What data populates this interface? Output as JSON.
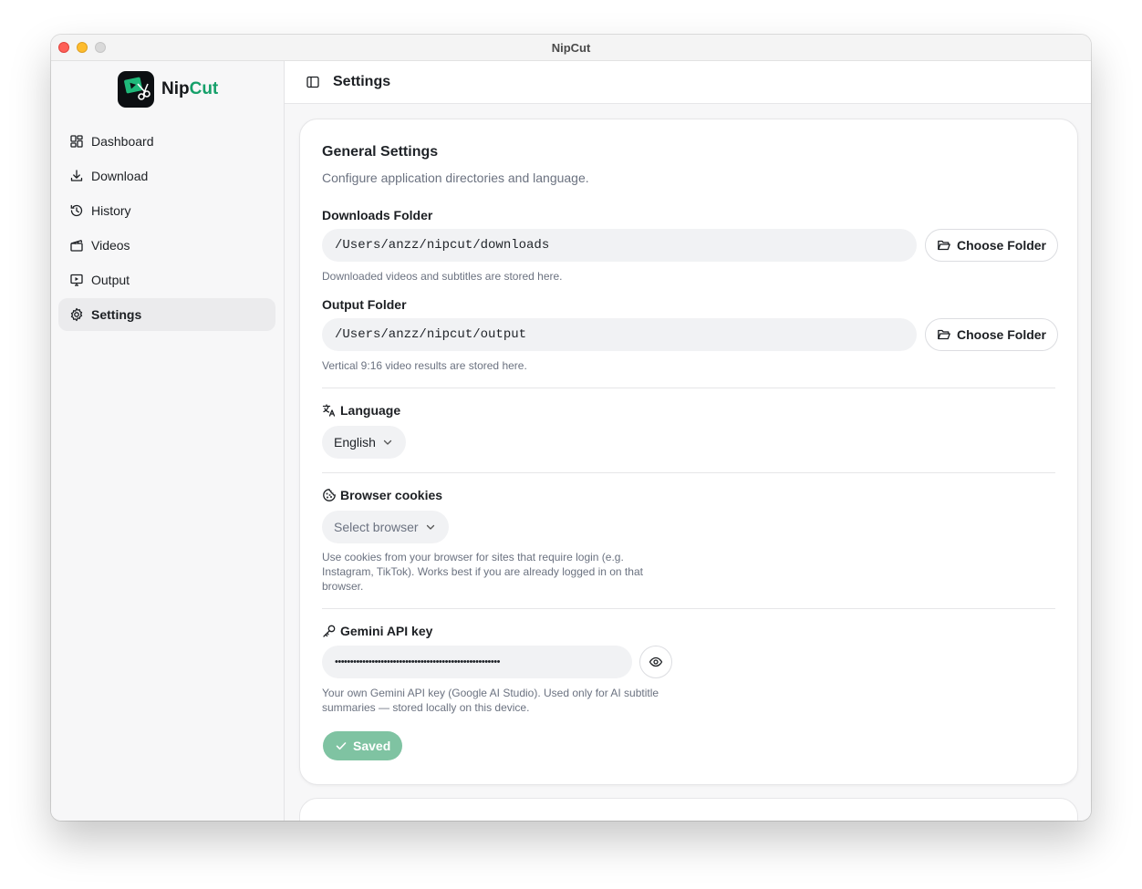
{
  "window": {
    "title": "NipCut"
  },
  "brand": {
    "name_prefix": "Nip",
    "name_accent": "Cut"
  },
  "sidebar": {
    "items": [
      {
        "label": "Dashboard",
        "icon": "dashboard-icon"
      },
      {
        "label": "Download",
        "icon": "download-icon"
      },
      {
        "label": "History",
        "icon": "history-icon"
      },
      {
        "label": "Videos",
        "icon": "videos-icon"
      },
      {
        "label": "Output",
        "icon": "output-icon"
      },
      {
        "label": "Settings",
        "icon": "settings-icon",
        "active": true
      }
    ]
  },
  "header": {
    "title": "Settings"
  },
  "general": {
    "title": "General Settings",
    "description": "Configure application directories and language.",
    "downloads": {
      "label": "Downloads Folder",
      "value": "/Users/anzz/nipcut/downloads",
      "button": "Choose Folder",
      "help": "Downloaded videos and subtitles are stored here."
    },
    "output": {
      "label": "Output Folder",
      "value": "/Users/anzz/nipcut/output",
      "button": "Choose Folder",
      "help": "Vertical 9:16 video results are stored here."
    },
    "language": {
      "label": "Language",
      "selected": "English"
    },
    "cookies": {
      "label": "Browser cookies",
      "placeholder": "Select browser",
      "help_line1": "Use cookies from your browser for sites that require login (e.g.",
      "help_line2": "Instagram, TikTok). Works best if you are already logged in on that",
      "help_line3": "browser."
    },
    "gemini": {
      "label": "Gemini API key",
      "value": "••••••••••••••••••••••••••••••••••••••••••••••••••••••",
      "help_line1": "Your own Gemini API key (Google AI Studio). Used only for AI subtitle",
      "help_line2": "summaries — stored locally on this device.",
      "saved_label": "Saved"
    }
  },
  "colors": {
    "accent": "#16a06a",
    "saved_bg": "#7fc3a2"
  }
}
